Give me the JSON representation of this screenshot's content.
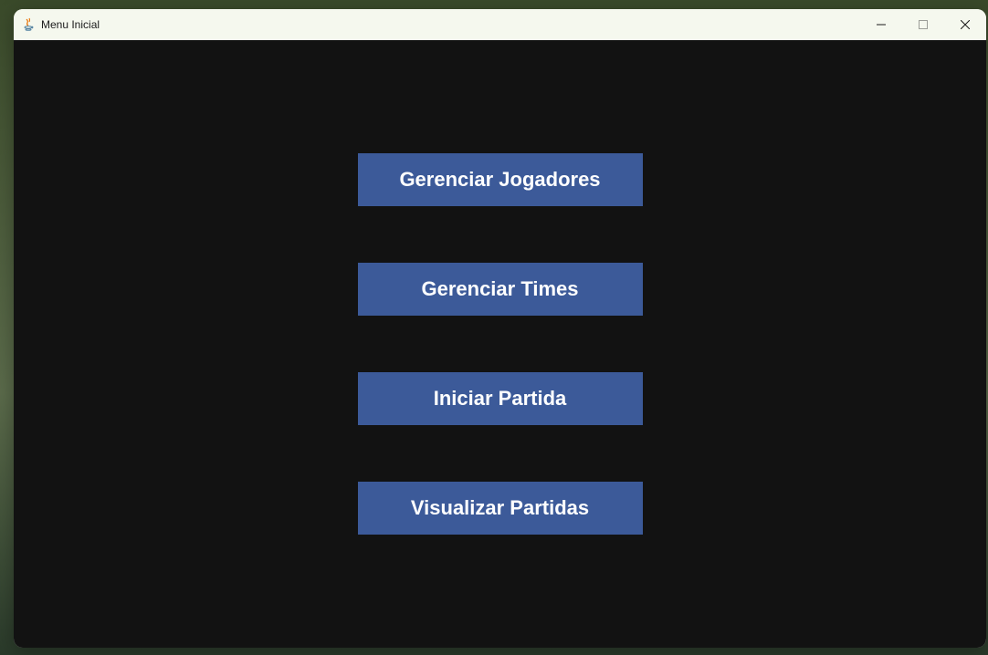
{
  "window": {
    "title": "Menu Inicial"
  },
  "buttons": {
    "manage_players": "Gerenciar Jogadores",
    "manage_teams": "Gerenciar Times",
    "start_match": "Iniciar Partida",
    "view_matches": "Visualizar Partidas"
  }
}
